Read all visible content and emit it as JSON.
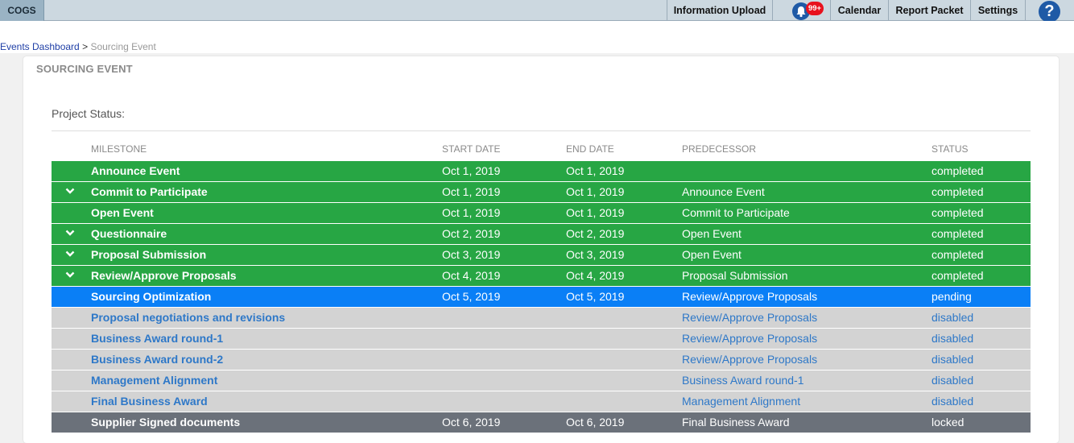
{
  "topbar": {
    "brand": "COGS",
    "nav": [
      "Information Upload",
      "Calendar",
      "Report Packet",
      "Settings"
    ],
    "notification_count": "99+",
    "help_glyph": "?"
  },
  "breadcrumb": {
    "parent": "Events Dashboard",
    "separator": ">",
    "current": "Sourcing Event"
  },
  "card": {
    "title": "SOURCING EVENT",
    "status_label": "Project Status:"
  },
  "table": {
    "headers": [
      "MILESTONE",
      "START DATE",
      "END DATE",
      "PREDECESSOR",
      "STATUS"
    ],
    "rows": [
      {
        "milestone": "Announce Event",
        "start": "Oct 1, 2019",
        "end": "Oct 1, 2019",
        "predecessor": "",
        "status": "completed",
        "expand": false
      },
      {
        "milestone": "Commit to Participate",
        "start": "Oct 1, 2019",
        "end": "Oct 1, 2019",
        "predecessor": "Announce Event",
        "status": "completed",
        "expand": true
      },
      {
        "milestone": "Open Event",
        "start": "Oct 1, 2019",
        "end": "Oct 1, 2019",
        "predecessor": "Commit to Participate",
        "status": "completed",
        "expand": false
      },
      {
        "milestone": "Questionnaire",
        "start": "Oct 2, 2019",
        "end": "Oct 2, 2019",
        "predecessor": "Open Event",
        "status": "completed",
        "expand": true
      },
      {
        "milestone": "Proposal Submission",
        "start": "Oct 3, 2019",
        "end": "Oct 3, 2019",
        "predecessor": "Open Event",
        "status": "completed",
        "expand": true
      },
      {
        "milestone": "Review/Approve Proposals",
        "start": "Oct 4, 2019",
        "end": "Oct 4, 2019",
        "predecessor": "Proposal Submission",
        "status": "completed",
        "expand": true
      },
      {
        "milestone": "Sourcing Optimization",
        "start": "Oct 5, 2019",
        "end": "Oct 5, 2019",
        "predecessor": "Review/Approve Proposals",
        "status": "pending",
        "expand": false
      },
      {
        "milestone": "Proposal negotiations and revisions",
        "start": "",
        "end": "",
        "predecessor": "Review/Approve Proposals",
        "status": "disabled",
        "expand": false
      },
      {
        "milestone": "Business Award round-1",
        "start": "",
        "end": "",
        "predecessor": "Review/Approve Proposals",
        "status": "disabled",
        "expand": false
      },
      {
        "milestone": "Business Award round-2",
        "start": "",
        "end": "",
        "predecessor": "Review/Approve Proposals",
        "status": "disabled",
        "expand": false
      },
      {
        "milestone": "Management Alignment",
        "start": "",
        "end": "",
        "predecessor": "Business Award round-1",
        "status": "disabled",
        "expand": false
      },
      {
        "milestone": "Final Business Award",
        "start": "",
        "end": "",
        "predecessor": "Management Alignment",
        "status": "disabled",
        "expand": false
      },
      {
        "milestone": "Supplier Signed documents",
        "start": "Oct 6, 2019",
        "end": "Oct 6, 2019",
        "predecessor": "Final Business Award",
        "status": "locked",
        "expand": false
      }
    ]
  },
  "colors": {
    "completed": "#27a644",
    "pending": "#0a7ff6",
    "disabled": "#d3d3d3",
    "locked": "#6b717a"
  },
  "icons": {
    "expand": "chevron-down-icon",
    "notifications": "bell-icon",
    "help": "help-icon"
  }
}
